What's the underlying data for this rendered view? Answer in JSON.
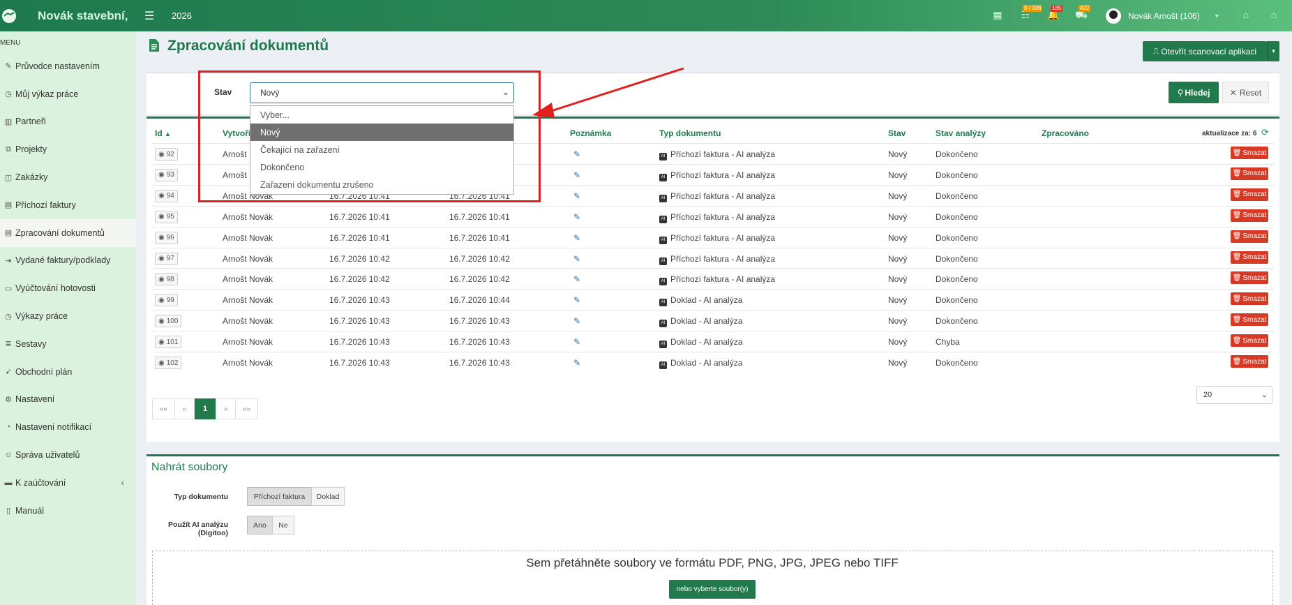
{
  "topbar": {
    "brand": "Novák stavební,",
    "year": "2026",
    "badges": {
      "tasks": "0 / 336",
      "alerts": "185",
      "cars": "422"
    },
    "user": "Novák Arnošt (106)"
  },
  "sidebar": {
    "menu_header": "MENU",
    "items": [
      {
        "label": "Průvodce nastavením",
        "icon": "wand-icon"
      },
      {
        "label": "Můj výkaz práce",
        "icon": "clock-icon"
      },
      {
        "label": "Partneři",
        "icon": "building-icon"
      },
      {
        "label": "Projekty",
        "icon": "cubes-icon"
      },
      {
        "label": "Zakázky",
        "icon": "cube-icon"
      },
      {
        "label": "Příchozí faktury",
        "icon": "file-in-icon"
      },
      {
        "label": "Zpracování dokumentů",
        "icon": "file-icon"
      },
      {
        "label": "Vydané faktury/podklady",
        "icon": "file-out-icon"
      },
      {
        "label": "Vyúčtování hotovosti",
        "icon": "money-icon"
      },
      {
        "label": "Výkazy práce",
        "icon": "clock-icon"
      },
      {
        "label": "Sestavy",
        "icon": "list-icon"
      },
      {
        "label": "Obchodní plán",
        "icon": "rocket-icon"
      },
      {
        "label": "Nastavení",
        "icon": "gears-icon"
      },
      {
        "label": "Nastavení notifikací",
        "icon": "bell-icon"
      },
      {
        "label": "Správa uživatelů",
        "icon": "users-icon"
      },
      {
        "label": "K zaúčtování",
        "icon": "folder-icon"
      },
      {
        "label": "Manuál",
        "icon": "book-icon"
      }
    ]
  },
  "page": {
    "title": "Zpracování dokumentů",
    "open_scan_button": "Otevřít scanovací aplikaci"
  },
  "filter": {
    "stav_label": "Stav",
    "stav_value": "Nový",
    "search_button": "Hledej",
    "reset_button": "Reset",
    "options": [
      "Vyber...",
      "Nový",
      "Čekající na zařazení",
      "Dokončeno",
      "Zařazení dokumentu zrušeno"
    ]
  },
  "table": {
    "headers": {
      "id": "Id",
      "created_by": "Vytvoři",
      "note": "Poznámka",
      "doc_type": "Typ dokumentu",
      "status": "Stav",
      "analysis": "Stav analýzy",
      "processed": "Zpracováno"
    },
    "update_text": "aktualizace za: 6",
    "delete_label": "Smazat",
    "rows": [
      {
        "id": "92",
        "author": "Arnošt",
        "created": "",
        "modified": "",
        "type": "Příchozí faktura - AI analýza",
        "status": "Nový",
        "analysis": "Dokončeno"
      },
      {
        "id": "93",
        "author": "Arnošt",
        "created": "",
        "modified": "",
        "type": "Příchozí faktura - AI analýza",
        "status": "Nový",
        "analysis": "Dokončeno"
      },
      {
        "id": "94",
        "author": "Arnošt Novák",
        "created": "16.7.2026 10:41",
        "modified": "16.7.2026 10:41",
        "type": "Příchozí faktura - AI analýza",
        "status": "Nový",
        "analysis": "Dokončeno"
      },
      {
        "id": "95",
        "author": "Arnošt Novák",
        "created": "16.7.2026 10:41",
        "modified": "16.7.2026 10:41",
        "type": "Příchozí faktura - AI analýza",
        "status": "Nový",
        "analysis": "Dokončeno"
      },
      {
        "id": "96",
        "author": "Arnošt Novák",
        "created": "16.7.2026 10:41",
        "modified": "16.7.2026 10:41",
        "type": "Příchozí faktura - AI analýza",
        "status": "Nový",
        "analysis": "Dokončeno"
      },
      {
        "id": "97",
        "author": "Arnošt Novák",
        "created": "16.7.2026 10:42",
        "modified": "16.7.2026 10:42",
        "type": "Příchozí faktura - AI analýza",
        "status": "Nový",
        "analysis": "Dokončeno"
      },
      {
        "id": "98",
        "author": "Arnošt Novák",
        "created": "16.7.2026 10:42",
        "modified": "16.7.2026 10:42",
        "type": "Příchozí faktura - AI analýza",
        "status": "Nový",
        "analysis": "Dokončeno"
      },
      {
        "id": "99",
        "author": "Arnošt Novák",
        "created": "16.7.2026 10:43",
        "modified": "16.7.2026 10:44",
        "type": "Doklad - AI analýza",
        "status": "Nový",
        "analysis": "Dokončeno"
      },
      {
        "id": "100",
        "author": "Arnošt Novák",
        "created": "16.7.2026 10:43",
        "modified": "16.7.2026 10:43",
        "type": "Doklad - AI analýza",
        "status": "Nový",
        "analysis": "Dokončeno"
      },
      {
        "id": "101",
        "author": "Arnošt Novák",
        "created": "16.7.2026 10:43",
        "modified": "16.7.2026 10:43",
        "type": "Doklad - AI analýza",
        "status": "Nový",
        "analysis": "Chyba"
      },
      {
        "id": "102",
        "author": "Arnošt Novák",
        "created": "16.7.2026 10:43",
        "modified": "16.7.2026 10:43",
        "type": "Doklad - AI analýza",
        "status": "Nový",
        "analysis": "Dokončeno"
      }
    ]
  },
  "pagination": {
    "first": "««",
    "prev": "«",
    "current": "1",
    "next": "»",
    "last": "»»",
    "page_size": "20"
  },
  "upload": {
    "title": "Nahrát soubory",
    "doc_type_label": "Typ dokumentu",
    "doc_type_options": [
      "Příchozí faktura",
      "Doklad"
    ],
    "ai_label_line1": "Použít AI analýzu",
    "ai_label_line2": "(Digitoo)",
    "ai_options": [
      "Ano",
      "Ne"
    ],
    "dropzone_text": "Sem přetáhněte soubory ve formátu PDF, PNG, JPG, JPEG nebo TIFF",
    "choose_button": "nebo vyberte soubor(y)"
  }
}
